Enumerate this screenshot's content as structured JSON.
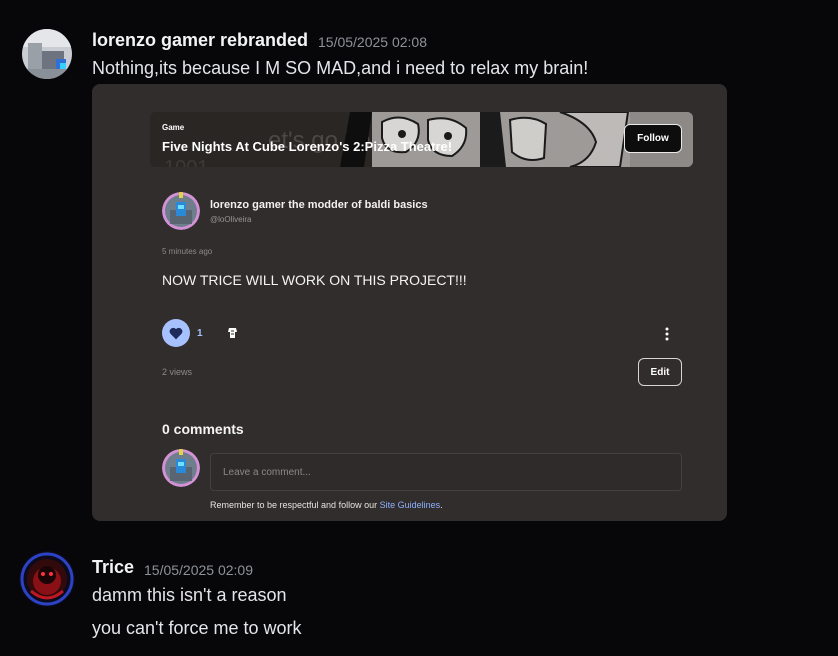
{
  "messages": [
    {
      "author": "lorenzo gamer rebranded",
      "timestamp": "15/05/2025 02:08",
      "lines": [
        "Nothing,its because I M SO MAD,and i need to relax my brain!"
      ]
    },
    {
      "author": "Trice",
      "timestamp": "15/05/2025 02:09",
      "lines": [
        "damm this isn't a reason",
        "you can't force me to work"
      ]
    }
  ],
  "embed": {
    "banner": {
      "category": "Game",
      "title": "Five Nights At Cube Lorenzo's 2:Pizza Theatre!",
      "follow_label": "Follow"
    },
    "post": {
      "author": "lorenzo gamer the modder of baldi basics",
      "handle": "@loOliveira",
      "time": "5 minutes ago",
      "text": "NOW TRICE WILL WORK ON THIS PROJECT!!!",
      "like_count": "1",
      "views": "2 views",
      "edit_label": "Edit"
    },
    "comments": {
      "heading": "0 comments",
      "placeholder": "Leave a comment...",
      "guidelines_prefix": "Remember to be respectful and follow our ",
      "guidelines_link": "Site Guidelines",
      "guidelines_suffix": "."
    }
  },
  "colors": {
    "background": "#070709",
    "embed_bg": "#312d2c",
    "accent_blue": "#a7c1ff",
    "link_blue": "#8fb0ff"
  },
  "icons": [
    "heart-icon",
    "share-icon",
    "more-vertical-icon"
  ]
}
